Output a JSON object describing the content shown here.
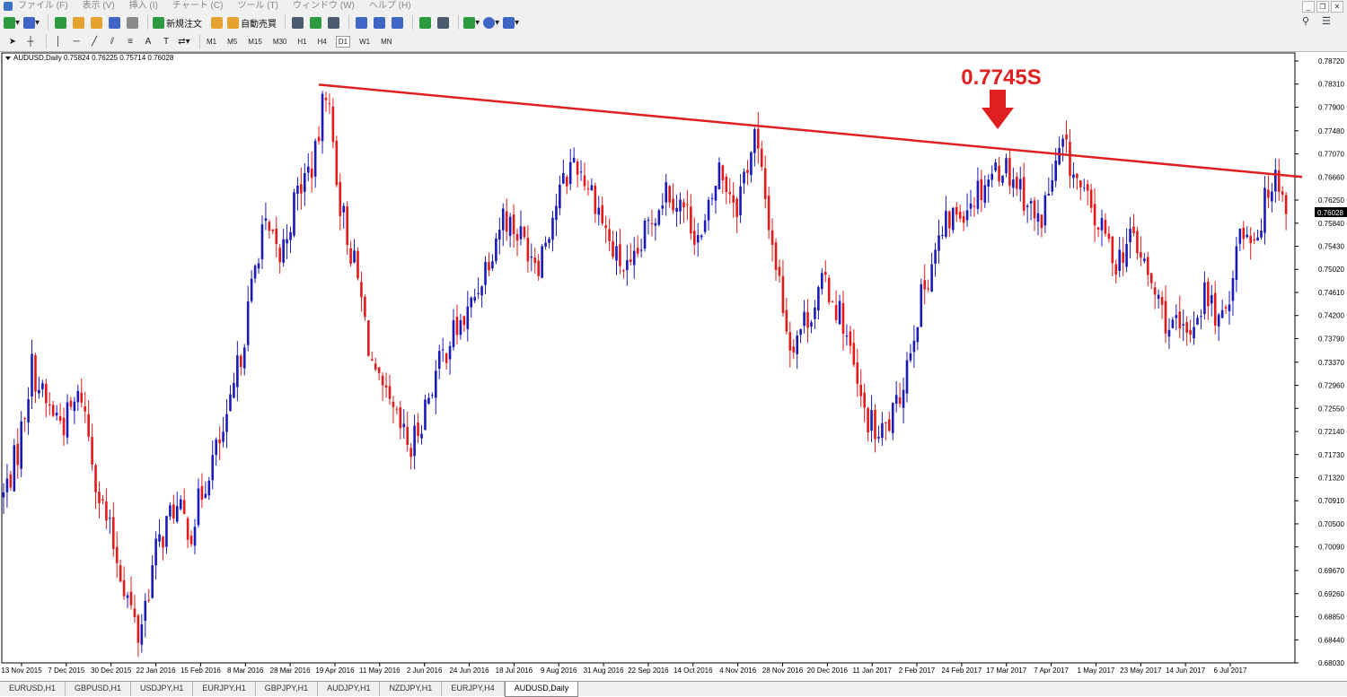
{
  "menu": {
    "items": [
      "ファイル (F)",
      "表示 (V)",
      "挿入 (I)",
      "チャート (C)",
      "ツール (T)",
      "ウィンドウ (W)",
      "ヘルプ (H)"
    ]
  },
  "toolbar": {
    "new_order_label": "新規注文",
    "auto_trading_label": "自動売買",
    "timeframes": [
      "M1",
      "M5",
      "M15",
      "M30",
      "H1",
      "H4",
      "D1",
      "W1",
      "MN"
    ],
    "active_timeframe": "D1"
  },
  "chart": {
    "header": "AUDUSD,Daily  0.75824 0.76225 0.75714 0.76028",
    "annotation": "0.7745S",
    "current_price": "0.76028"
  },
  "colors": {
    "bull": "#1a1ab8",
    "bear": "#e31a1a",
    "trendline": "#e02020",
    "arrow": "#e02020",
    "price_tag_bg": "#000000"
  },
  "chart_data": {
    "type": "candlestick",
    "symbol": "AUDUSD",
    "timeframe": "Daily",
    "y_ticks": [
      "0.78720",
      "0.78310",
      "0.77900",
      "0.77480",
      "0.77070",
      "0.76660",
      "0.76250",
      "0.75840",
      "0.75430",
      "0.75020",
      "0.74610",
      "0.74200",
      "0.73790",
      "0.73370",
      "0.72960",
      "0.72550",
      "0.72140",
      "0.71730",
      "0.71320",
      "0.70910",
      "0.70500",
      "0.70090",
      "0.69670",
      "0.69260",
      "0.68850",
      "0.68440",
      "0.68030"
    ],
    "ylim": [
      0.6803,
      0.7872
    ],
    "x_ticks": [
      "13 Nov 2015",
      "7 Dec 2015",
      "30 Dec 2015",
      "22 Jan 2016",
      "15 Feb 2016",
      "8 Mar 2016",
      "28 Mar 2016",
      "19 Apr 2016",
      "11 May 2016",
      "2 Jun 2016",
      "24 Jun 2016",
      "18 Jul 2016",
      "9 Aug 2016",
      "31 Aug 2016",
      "22 Sep 2016",
      "14 Oct 2016",
      "4 Nov 2016",
      "28 Nov 2016",
      "20 Dec 2016",
      "11 Jan 2017",
      "2 Feb 2017",
      "24 Feb 2017",
      "17 Mar 2017",
      "7 Apr 2017",
      "1 May 2017",
      "23 May 2017",
      "14 Jun 2017",
      "6 Jul 2017"
    ],
    "path_closes": [
      [
        0,
        0.71
      ],
      [
        4,
        0.718
      ],
      [
        8,
        0.733
      ],
      [
        12,
        0.726
      ],
      [
        17,
        0.723
      ],
      [
        22,
        0.728
      ],
      [
        27,
        0.71
      ],
      [
        32,
        0.699
      ],
      [
        38,
        0.685
      ],
      [
        43,
        0.7
      ],
      [
        48,
        0.708
      ],
      [
        53,
        0.704
      ],
      [
        58,
        0.715
      ],
      [
        63,
        0.722
      ],
      [
        68,
        0.739
      ],
      [
        73,
        0.758
      ],
      [
        78,
        0.752
      ],
      [
        83,
        0.764
      ],
      [
        88,
        0.77
      ],
      [
        91,
        0.783
      ],
      [
        95,
        0.762
      ],
      [
        100,
        0.748
      ],
      [
        105,
        0.73
      ],
      [
        110,
        0.724
      ],
      [
        115,
        0.718
      ],
      [
        121,
        0.73
      ],
      [
        126,
        0.738
      ],
      [
        131,
        0.742
      ],
      [
        136,
        0.751
      ],
      [
        141,
        0.76
      ],
      [
        146,
        0.756
      ],
      [
        151,
        0.752
      ],
      [
        156,
        0.762
      ],
      [
        161,
        0.77
      ],
      [
        167,
        0.763
      ],
      [
        172,
        0.753
      ],
      [
        177,
        0.749
      ],
      [
        182,
        0.758
      ],
      [
        187,
        0.765
      ],
      [
        192,
        0.761
      ],
      [
        197,
        0.755
      ],
      [
        202,
        0.768
      ],
      [
        207,
        0.762
      ],
      [
        212,
        0.774
      ],
      [
        217,
        0.755
      ],
      [
        222,
        0.737
      ],
      [
        227,
        0.742
      ],
      [
        232,
        0.748
      ],
      [
        237,
        0.741
      ],
      [
        242,
        0.726
      ],
      [
        247,
        0.72
      ],
      [
        252,
        0.725
      ],
      [
        257,
        0.74
      ],
      [
        262,
        0.752
      ],
      [
        267,
        0.759
      ],
      [
        272,
        0.762
      ],
      [
        277,
        0.766
      ],
      [
        282,
        0.769
      ],
      [
        287,
        0.765
      ],
      [
        292,
        0.758
      ],
      [
        296,
        0.766
      ],
      [
        299,
        0.772
      ],
      [
        304,
        0.764
      ],
      [
        309,
        0.758
      ],
      [
        314,
        0.752
      ],
      [
        319,
        0.756
      ],
      [
        324,
        0.747
      ],
      [
        329,
        0.74
      ],
      [
        334,
        0.738
      ],
      [
        339,
        0.746
      ],
      [
        344,
        0.74
      ],
      [
        349,
        0.757
      ],
      [
        354,
        0.757
      ],
      [
        359,
        0.769
      ],
      [
        362,
        0.76
      ]
    ],
    "trendline": {
      "from": {
        "date": "19 Apr 2016",
        "value": 0.783
      },
      "to": {
        "date": "6 Jul 2017",
        "value": 0.7698
      }
    },
    "grid": false
  },
  "bottom_tabs": [
    "EURUSD,H1",
    "GBPUSD,H1",
    "USDJPY,H1",
    "EURJPY,H1",
    "GBPJPY,H1",
    "AUDJPY,H1",
    "NZDJPY,H1",
    "EURJPY,H4",
    "AUDUSD,Daily"
  ],
  "active_tab": "AUDUSD,Daily"
}
